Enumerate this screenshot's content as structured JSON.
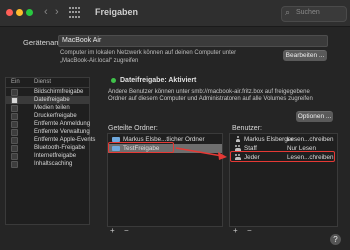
{
  "window": {
    "title": "Freigaben",
    "search_placeholder": "Suchen",
    "back_label": "‹",
    "forward_label": "›"
  },
  "computer_name": {
    "label": "Gerätename:",
    "value": "MacBook Air",
    "info": "Computer im lokalen Netzwerk können auf deinen Computer unter „MacBook-Air.local“ zugreifen",
    "edit_button": "Bearbeiten ..."
  },
  "services": {
    "header_on": "Ein",
    "header_service": "Dienst",
    "items": [
      {
        "label": "Bildschirmfreigabe",
        "checked": false,
        "selected": false
      },
      {
        "label": "Dateifreigabe",
        "checked": true,
        "selected": true
      },
      {
        "label": "Medien teilen",
        "checked": false,
        "selected": false
      },
      {
        "label": "Druckerfreigabe",
        "checked": false,
        "selected": false
      },
      {
        "label": "Entfernte Anmeldung",
        "checked": false,
        "selected": false
      },
      {
        "label": "Entfernte Verwaltung",
        "checked": false,
        "selected": false
      },
      {
        "label": "Entfernte Apple-Events",
        "checked": false,
        "selected": false
      },
      {
        "label": "Bluetooth-Freigabe",
        "checked": false,
        "selected": false
      },
      {
        "label": "Internetfreigabe",
        "checked": false,
        "selected": false
      },
      {
        "label": "Inhaltscaching",
        "checked": false,
        "selected": false
      }
    ]
  },
  "status": {
    "text": "Dateifreigabe: Aktiviert",
    "description": "Andere Benutzer können unter smb://macbook-air.fritz.box auf freigegebene Ordner auf diesem Computer und Administratoren auf alle Volumes zugreifen",
    "options_button": "Optionen ..."
  },
  "shared_folders": {
    "title": "Geteilte Ordner:",
    "items": [
      {
        "label": "Markus Elsbe...tlicher Ordner"
      },
      {
        "label": "TestFreigabe"
      }
    ]
  },
  "users": {
    "title": "Benutzer:",
    "items": [
      {
        "name": "Markus Elsberger",
        "permission": "Lesen...chreiben"
      },
      {
        "name": "Staff",
        "permission": "Nur Lesen"
      },
      {
        "name": "Jeder",
        "permission": "Lesen...chreiben"
      }
    ]
  },
  "controls": {
    "add": "+",
    "remove": "−",
    "help": "?"
  },
  "colors": {
    "status_green": "#3fc24a",
    "annotation_red": "#e53935"
  }
}
